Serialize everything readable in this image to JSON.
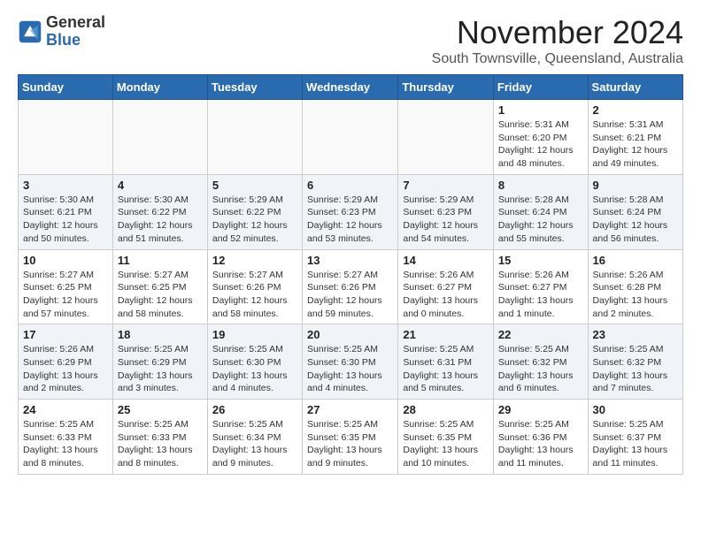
{
  "header": {
    "logo_line1": "General",
    "logo_line2": "Blue",
    "month_title": "November 2024",
    "subtitle": "South Townsville, Queensland, Australia"
  },
  "weekdays": [
    "Sunday",
    "Monday",
    "Tuesday",
    "Wednesday",
    "Thursday",
    "Friday",
    "Saturday"
  ],
  "weeks": [
    {
      "shaded": false,
      "days": [
        {
          "date": "",
          "info": ""
        },
        {
          "date": "",
          "info": ""
        },
        {
          "date": "",
          "info": ""
        },
        {
          "date": "",
          "info": ""
        },
        {
          "date": "",
          "info": ""
        },
        {
          "date": "1",
          "info": "Sunrise: 5:31 AM\nSunset: 6:20 PM\nDaylight: 12 hours and 48 minutes."
        },
        {
          "date": "2",
          "info": "Sunrise: 5:31 AM\nSunset: 6:21 PM\nDaylight: 12 hours and 49 minutes."
        }
      ]
    },
    {
      "shaded": true,
      "days": [
        {
          "date": "3",
          "info": "Sunrise: 5:30 AM\nSunset: 6:21 PM\nDaylight: 12 hours and 50 minutes."
        },
        {
          "date": "4",
          "info": "Sunrise: 5:30 AM\nSunset: 6:22 PM\nDaylight: 12 hours and 51 minutes."
        },
        {
          "date": "5",
          "info": "Sunrise: 5:29 AM\nSunset: 6:22 PM\nDaylight: 12 hours and 52 minutes."
        },
        {
          "date": "6",
          "info": "Sunrise: 5:29 AM\nSunset: 6:23 PM\nDaylight: 12 hours and 53 minutes."
        },
        {
          "date": "7",
          "info": "Sunrise: 5:29 AM\nSunset: 6:23 PM\nDaylight: 12 hours and 54 minutes."
        },
        {
          "date": "8",
          "info": "Sunrise: 5:28 AM\nSunset: 6:24 PM\nDaylight: 12 hours and 55 minutes."
        },
        {
          "date": "9",
          "info": "Sunrise: 5:28 AM\nSunset: 6:24 PM\nDaylight: 12 hours and 56 minutes."
        }
      ]
    },
    {
      "shaded": false,
      "days": [
        {
          "date": "10",
          "info": "Sunrise: 5:27 AM\nSunset: 6:25 PM\nDaylight: 12 hours and 57 minutes."
        },
        {
          "date": "11",
          "info": "Sunrise: 5:27 AM\nSunset: 6:25 PM\nDaylight: 12 hours and 58 minutes."
        },
        {
          "date": "12",
          "info": "Sunrise: 5:27 AM\nSunset: 6:26 PM\nDaylight: 12 hours and 58 minutes."
        },
        {
          "date": "13",
          "info": "Sunrise: 5:27 AM\nSunset: 6:26 PM\nDaylight: 12 hours and 59 minutes."
        },
        {
          "date": "14",
          "info": "Sunrise: 5:26 AM\nSunset: 6:27 PM\nDaylight: 13 hours and 0 minutes."
        },
        {
          "date": "15",
          "info": "Sunrise: 5:26 AM\nSunset: 6:27 PM\nDaylight: 13 hours and 1 minute."
        },
        {
          "date": "16",
          "info": "Sunrise: 5:26 AM\nSunset: 6:28 PM\nDaylight: 13 hours and 2 minutes."
        }
      ]
    },
    {
      "shaded": true,
      "days": [
        {
          "date": "17",
          "info": "Sunrise: 5:26 AM\nSunset: 6:29 PM\nDaylight: 13 hours and 2 minutes."
        },
        {
          "date": "18",
          "info": "Sunrise: 5:25 AM\nSunset: 6:29 PM\nDaylight: 13 hours and 3 minutes."
        },
        {
          "date": "19",
          "info": "Sunrise: 5:25 AM\nSunset: 6:30 PM\nDaylight: 13 hours and 4 minutes."
        },
        {
          "date": "20",
          "info": "Sunrise: 5:25 AM\nSunset: 6:30 PM\nDaylight: 13 hours and 4 minutes."
        },
        {
          "date": "21",
          "info": "Sunrise: 5:25 AM\nSunset: 6:31 PM\nDaylight: 13 hours and 5 minutes."
        },
        {
          "date": "22",
          "info": "Sunrise: 5:25 AM\nSunset: 6:32 PM\nDaylight: 13 hours and 6 minutes."
        },
        {
          "date": "23",
          "info": "Sunrise: 5:25 AM\nSunset: 6:32 PM\nDaylight: 13 hours and 7 minutes."
        }
      ]
    },
    {
      "shaded": false,
      "days": [
        {
          "date": "24",
          "info": "Sunrise: 5:25 AM\nSunset: 6:33 PM\nDaylight: 13 hours and 8 minutes."
        },
        {
          "date": "25",
          "info": "Sunrise: 5:25 AM\nSunset: 6:33 PM\nDaylight: 13 hours and 8 minutes."
        },
        {
          "date": "26",
          "info": "Sunrise: 5:25 AM\nSunset: 6:34 PM\nDaylight: 13 hours and 9 minutes."
        },
        {
          "date": "27",
          "info": "Sunrise: 5:25 AM\nSunset: 6:35 PM\nDaylight: 13 hours and 9 minutes."
        },
        {
          "date": "28",
          "info": "Sunrise: 5:25 AM\nSunset: 6:35 PM\nDaylight: 13 hours and 10 minutes."
        },
        {
          "date": "29",
          "info": "Sunrise: 5:25 AM\nSunset: 6:36 PM\nDaylight: 13 hours and 11 minutes."
        },
        {
          "date": "30",
          "info": "Sunrise: 5:25 AM\nSunset: 6:37 PM\nDaylight: 13 hours and 11 minutes."
        }
      ]
    }
  ]
}
